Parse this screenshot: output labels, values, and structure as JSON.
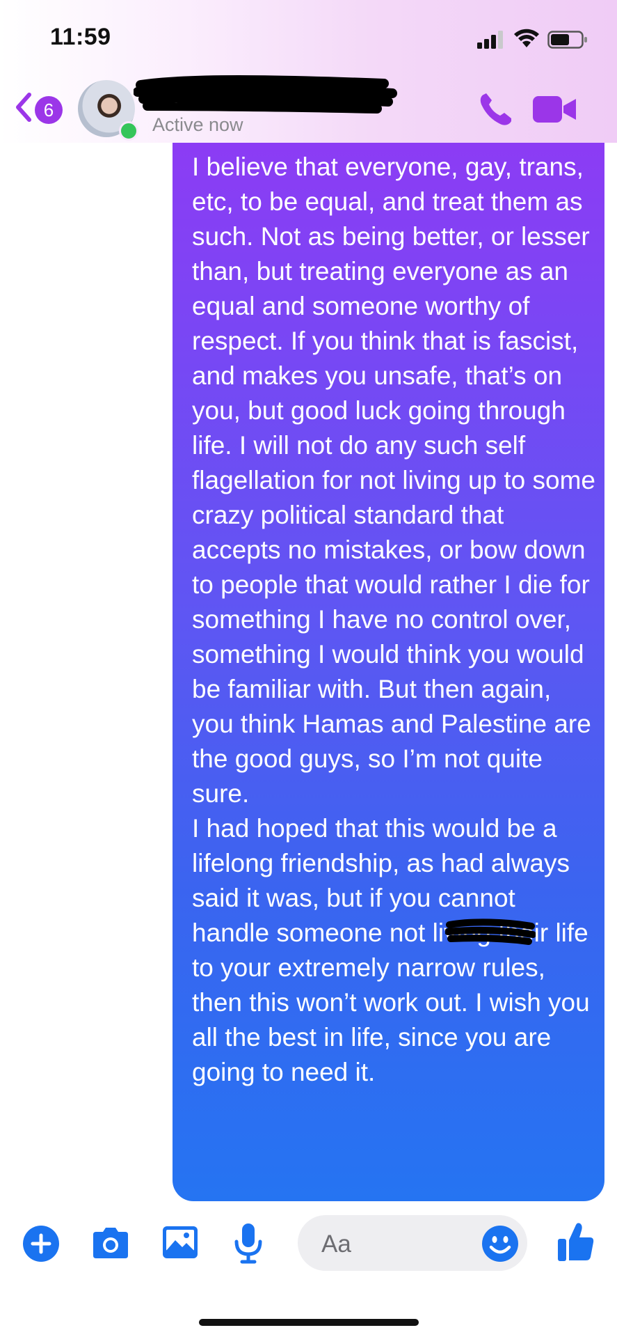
{
  "status_bar": {
    "time": "11:59"
  },
  "header": {
    "unread_count": "6",
    "presence": "Active now",
    "accent_color": "#9b36e8"
  },
  "message": {
    "paragraph_1": "I believe that everyone, gay, trans, etc, to be equal, and treat them as such. Not as being better, or lesser than, but treating everyone as an equal and someone worthy of respect. If you think that is fascist, and makes you unsafe, that’s on you, but good luck going through life. I will not do any such self flagellation for not living up to some crazy political standard that accepts no mistakes, or bow down to people that would rather I die for something I have no control over, something I would think you would be familiar with. But then again, you think Hamas and Palestine are the good guys, so I’m not quite sure.",
    "paragraph_2": "I had hoped that this would be a lifelong friendship, as          had always said it was, but if you cannot handle someone not living their life to your extremely narrow rules, then this won’t work out. I wish you all the best in life, since you are going to need it."
  },
  "composer": {
    "placeholder": "Aa",
    "icons": [
      "plus-icon",
      "camera-icon",
      "image-icon",
      "microphone-icon",
      "emoji-icon",
      "thumbs-up-icon"
    ],
    "icon_color": "#1a73f0"
  }
}
